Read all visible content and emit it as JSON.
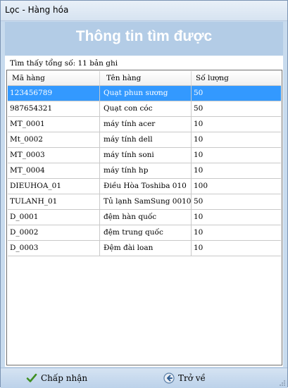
{
  "window": {
    "title": "Lọc - Hàng hóa"
  },
  "header": {
    "heading": "Thông tin tìm được"
  },
  "summary": {
    "text": "Tìm thấy tổng số: 11 bản ghi"
  },
  "grid": {
    "columns": [
      "Mã hàng",
      "Tên hàng",
      "Số lượng"
    ],
    "rows": [
      {
        "code": "123456789",
        "name": "Quạt phun sương",
        "qty": "50",
        "selected": true
      },
      {
        "code": "987654321",
        "name": "Quạt con cóc",
        "qty": "50"
      },
      {
        "code": "MT_0001",
        "name": "máy tính acer",
        "qty": "10"
      },
      {
        "code": "Mt_0002",
        "name": "máy tính dell",
        "qty": "10"
      },
      {
        "code": "MT_0003",
        "name": "máy tính soni",
        "qty": "10"
      },
      {
        "code": "MT_0004",
        "name": "máy tính hp",
        "qty": "10"
      },
      {
        "code": "DIEUHOA_01",
        "name": "Điều Hòa Toshiba 010",
        "qty": "100"
      },
      {
        "code": "TULANH_01",
        "name": "Tủ lạnh SamSung 0010",
        "qty": "50"
      },
      {
        "code": "D_0001",
        "name": "đệm hàn quốc",
        "qty": "10"
      },
      {
        "code": "D_0002",
        "name": "đệm trung quốc",
        "qty": "10"
      },
      {
        "code": "D_0003",
        "name": "Đệm đài loan",
        "qty": "10"
      }
    ]
  },
  "footer": {
    "accept_label": "Chấp nhận",
    "accept_icon": "checkmark-icon",
    "back_label": "Trở về",
    "back_icon": "back-arrow-icon"
  },
  "colors": {
    "selection": "#3399ff",
    "header_panel": "#b3cce6",
    "window_bg": "#c8dbee"
  }
}
